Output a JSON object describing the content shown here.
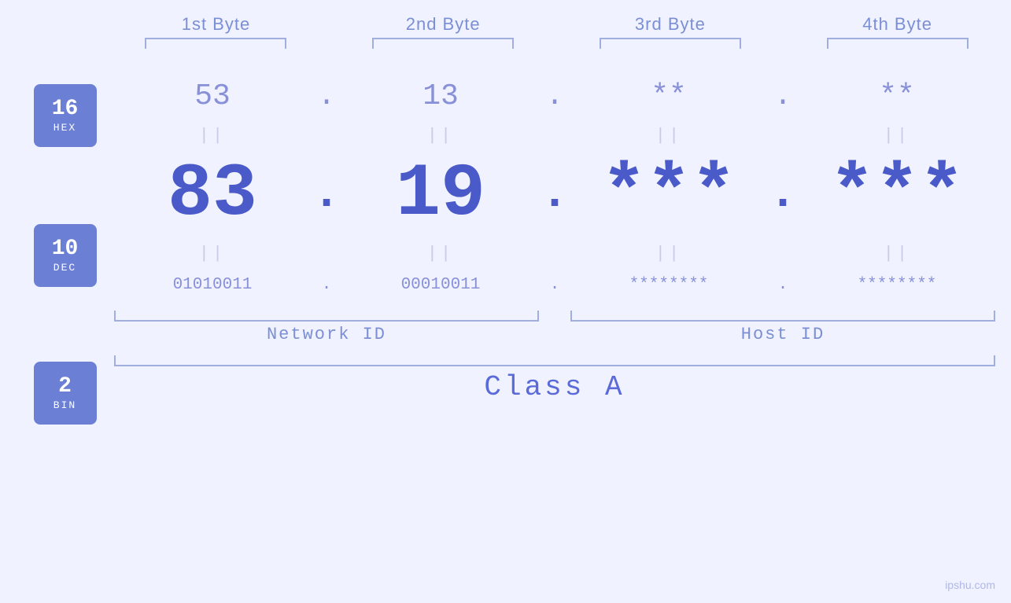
{
  "page": {
    "background": "#f0f2ff",
    "watermark": "ipshu.com"
  },
  "headers": {
    "byte1": "1st Byte",
    "byte2": "2nd Byte",
    "byte3": "3rd Byte",
    "byte4": "4th Byte"
  },
  "badges": {
    "hex": {
      "num": "16",
      "label": "HEX"
    },
    "dec": {
      "num": "10",
      "label": "DEC"
    },
    "bin": {
      "num": "2",
      "label": "BIN"
    }
  },
  "hex_row": {
    "b1": "53",
    "b2": "13",
    "b3": "**",
    "b4": "**",
    "dots": [
      ".",
      ".",
      ".",
      "."
    ]
  },
  "dec_row": {
    "b1": "83",
    "b2": "19",
    "b3": "***",
    "b4": "***",
    "dots": [
      ".",
      ".",
      ".",
      "."
    ]
  },
  "bin_row": {
    "b1": "01010011",
    "b2": "00010011",
    "b3": "********",
    "b4": "********",
    "dots": [
      ".",
      ".",
      ".",
      "."
    ]
  },
  "equals": "||",
  "labels": {
    "network_id": "Network ID",
    "host_id": "Host ID",
    "class": "Class A"
  }
}
